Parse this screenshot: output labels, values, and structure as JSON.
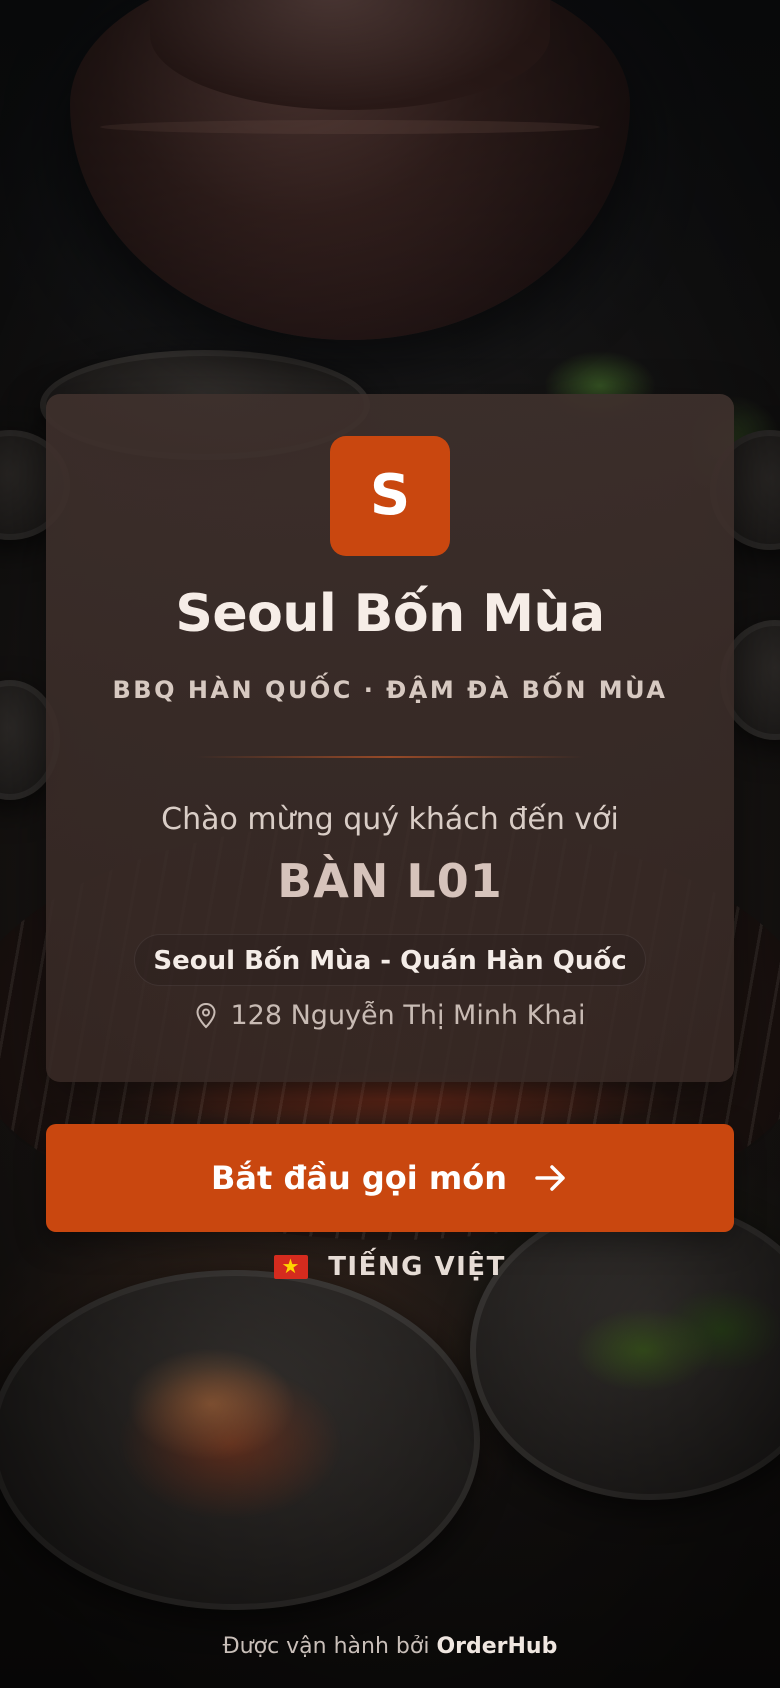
{
  "restaurant": {
    "logo_letter": "S",
    "name": "Seoul Bốn Mùa",
    "tagline": "BBQ HÀN QUỐC · ĐẬM ĐÀ BỐN MÙA"
  },
  "welcome": {
    "greeting": "Chào mừng quý khách đến với",
    "table": "BÀN L01",
    "branch_name": "Seoul Bốn Mùa - Quán Hàn Quốc",
    "address": "128 Nguyễn Thị Minh Khai"
  },
  "cta": {
    "label": "Bắt đầu gọi món"
  },
  "language": {
    "label": "TIẾNG VIỆT",
    "flag_icon": "vietnam-flag-icon"
  },
  "footer": {
    "prefix": "Được vận hành bởi",
    "brand": "OrderHub"
  },
  "colors": {
    "accent": "#c9470f",
    "card": "#3e302c"
  }
}
